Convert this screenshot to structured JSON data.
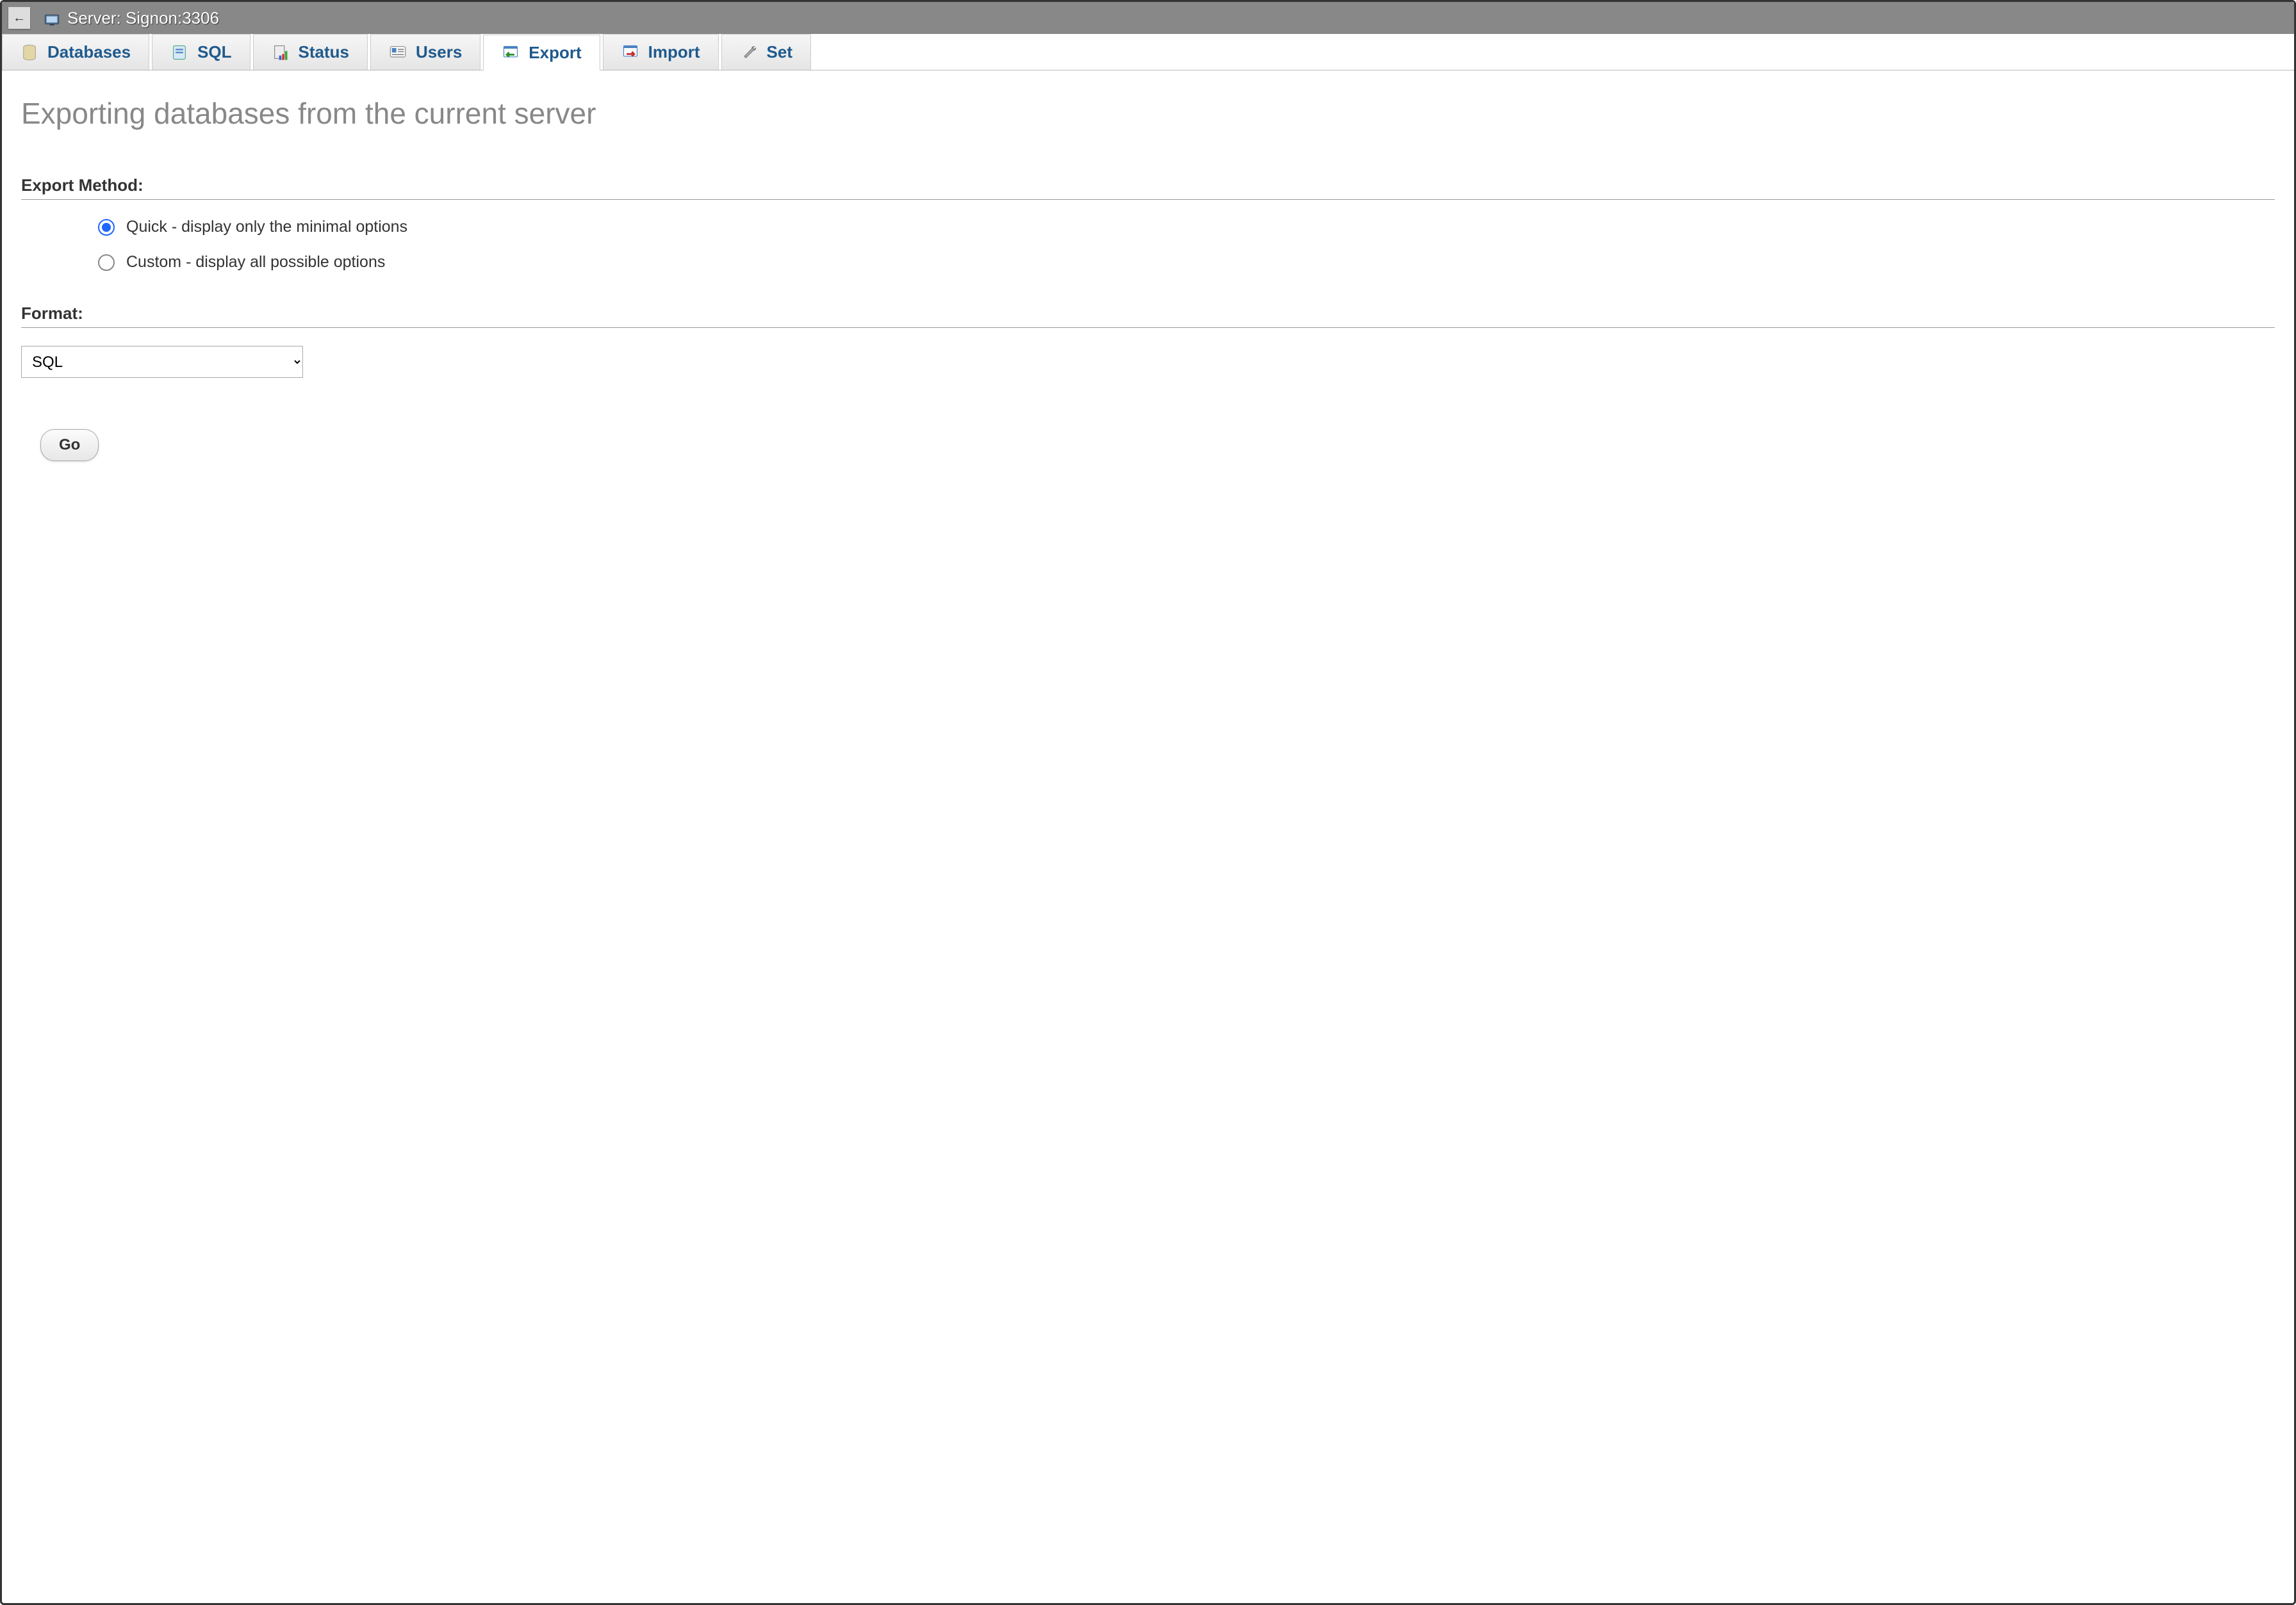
{
  "header": {
    "server_label": "Server: Signon:3306"
  },
  "tabs": [
    {
      "label": "Databases",
      "icon": "database-icon",
      "active": false
    },
    {
      "label": "SQL",
      "icon": "sql-icon",
      "active": false
    },
    {
      "label": "Status",
      "icon": "status-icon",
      "active": false
    },
    {
      "label": "Users",
      "icon": "users-icon",
      "active": false
    },
    {
      "label": "Export",
      "icon": "export-icon",
      "active": true
    },
    {
      "label": "Import",
      "icon": "import-icon",
      "active": false
    },
    {
      "label": "Set",
      "icon": "settings-icon",
      "active": false
    }
  ],
  "page": {
    "title": "Exporting databases from the current server",
    "method_heading": "Export Method:",
    "format_heading": "Format:"
  },
  "export_method": {
    "options": [
      {
        "value": "quick",
        "label": "Quick - display only the minimal options",
        "selected": true
      },
      {
        "value": "custom",
        "label": "Custom - display all possible options",
        "selected": false
      }
    ]
  },
  "format": {
    "selected": "SQL"
  },
  "actions": {
    "go_label": "Go"
  }
}
